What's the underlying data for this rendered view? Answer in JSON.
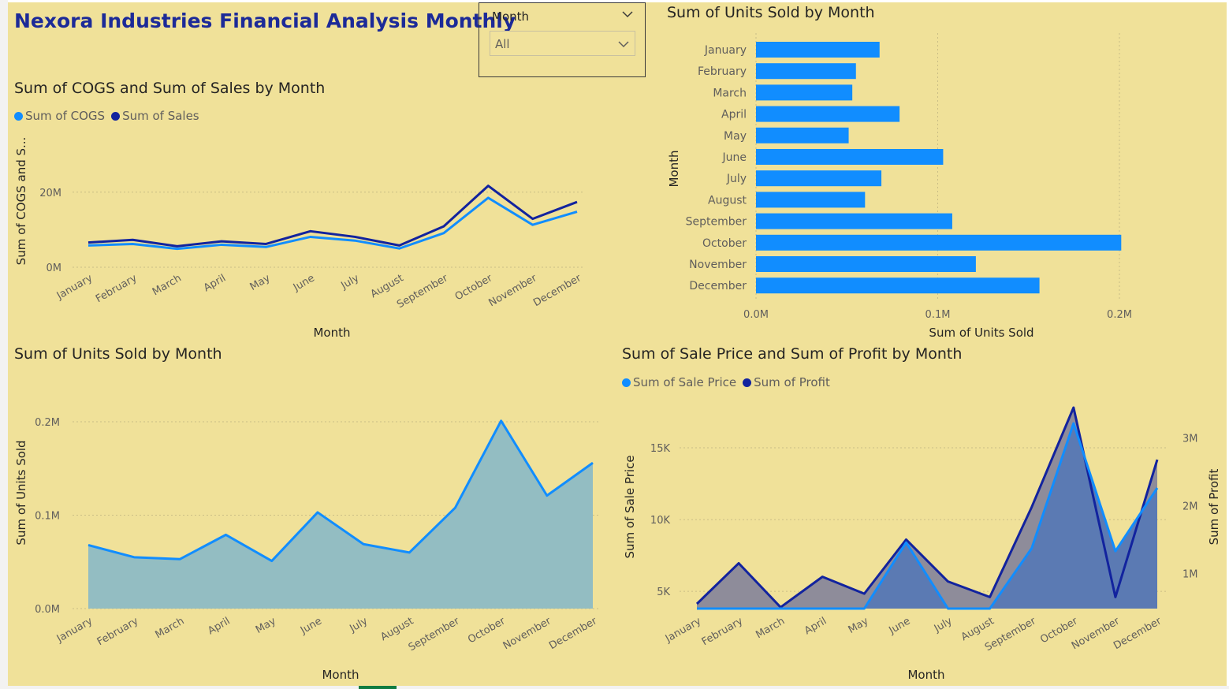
{
  "report": {
    "title": "Nexora Industries Financial Analysis Monthly"
  },
  "colors": {
    "background": "#f0e199",
    "light_blue": "#118dff",
    "dark_navy": "#12239e",
    "area_teal": "#93bdc2",
    "area_gray": "#8e8c9a",
    "area_blue": "#5b7ab3"
  },
  "slicer": {
    "header": "Month",
    "selected": "All"
  },
  "visuals": {
    "cogs_sales": {
      "title": "Sum of COGS and Sum of Sales by Month",
      "legend": [
        "Sum of COGS",
        "Sum of  Sales"
      ],
      "xlabel": "Month",
      "ylabel": "Sum of COGS and S..."
    },
    "units_bar": {
      "title": "Sum of Units Sold by Month",
      "xlabel": "Sum of Units Sold",
      "ylabel": "Month"
    },
    "units_area": {
      "title": "Sum of Units Sold by Month",
      "xlabel": "Month",
      "ylabel": "Sum of Units Sold"
    },
    "price_profit": {
      "title": "Sum of Sale Price and Sum of Profit by Month",
      "legend": [
        "Sum of Sale Price",
        "Sum of Profit"
      ],
      "xlabel": "Month",
      "ylabel_left": "Sum of Sale Price",
      "ylabel_right": "Sum of Profit"
    }
  },
  "chart_data": [
    {
      "type": "line",
      "title": "Sum of COGS and Sum of Sales by Month",
      "categories": [
        "January",
        "February",
        "March",
        "April",
        "May",
        "June",
        "July",
        "August",
        "September",
        "October",
        "November",
        "December"
      ],
      "series": [
        {
          "name": "Sum of COGS",
          "color": "#118dff",
          "values": [
            5.8,
            6.2,
            4.9,
            6.0,
            5.4,
            8.1,
            7.1,
            5.0,
            9.1,
            18.5,
            11.3,
            14.8
          ]
        },
        {
          "name": "Sum of  Sales",
          "color": "#12239e",
          "values": [
            6.6,
            7.3,
            5.6,
            6.9,
            6.2,
            9.6,
            8.1,
            5.8,
            10.9,
            21.7,
            12.9,
            17.4
          ]
        }
      ],
      "ytick_labels": [
        "0M",
        "20M"
      ],
      "ytick_values": [
        0,
        20
      ],
      "ylim": [
        0,
        25
      ],
      "units": "M",
      "xlabel": "Month",
      "ylabel": "Sum of COGS and S...",
      "legend": "top-left",
      "grid": true
    },
    {
      "type": "bar",
      "orientation": "horizontal",
      "title": "Sum of Units Sold by Month",
      "categories": [
        "January",
        "February",
        "March",
        "April",
        "May",
        "June",
        "July",
        "August",
        "September",
        "October",
        "November",
        "December"
      ],
      "values": [
        0.068,
        0.055,
        0.053,
        0.079,
        0.051,
        0.103,
        0.069,
        0.06,
        0.108,
        0.201,
        0.121,
        0.156
      ],
      "color": "#118dff",
      "xtick_labels": [
        "0.0M",
        "0.1M",
        "0.2M"
      ],
      "xtick_values": [
        0,
        0.1,
        0.2
      ],
      "xlim": [
        0,
        0.2
      ],
      "xlabel": "Sum of Units Sold",
      "ylabel": "Month",
      "grid": true
    },
    {
      "type": "area",
      "title": "Sum of Units Sold by Month",
      "categories": [
        "January",
        "February",
        "March",
        "April",
        "May",
        "June",
        "July",
        "August",
        "September",
        "October",
        "November",
        "December"
      ],
      "values": [
        0.068,
        0.055,
        0.053,
        0.079,
        0.051,
        0.103,
        0.069,
        0.06,
        0.108,
        0.201,
        0.121,
        0.156
      ],
      "line_color": "#118dff",
      "fill_color": "#93bdc2",
      "ytick_labels": [
        "0.0M",
        "0.1M",
        "0.2M"
      ],
      "ytick_values": [
        0,
        0.1,
        0.2
      ],
      "ylim": [
        0,
        0.2
      ],
      "xlabel": "Month",
      "ylabel": "Sum of Units Sold",
      "grid": true
    },
    {
      "type": "area",
      "title": "Sum of Sale Price and Sum of Profit by Month",
      "categories": [
        "January",
        "February",
        "March",
        "April",
        "May",
        "June",
        "July",
        "August",
        "September",
        "October",
        "November",
        "December"
      ],
      "series": [
        {
          "name": "Sum of Sale Price",
          "axis": "left",
          "color": "#118dff",
          "values": [
            3800,
            3800,
            3800,
            3800,
            3800,
            8400,
            3800,
            3800,
            8000,
            16700,
            7800,
            12200
          ]
        },
        {
          "name": "Sum of Profit",
          "axis": "right",
          "color": "#12239e",
          "values": [
            0.55,
            1.15,
            0.5,
            0.95,
            0.7,
            1.5,
            0.88,
            0.65,
            1.98,
            3.45,
            0.65,
            2.68
          ]
        }
      ],
      "ytick_labels_left": [
        "5K",
        "10K",
        "15K"
      ],
      "ytick_values_left": [
        5000,
        10000,
        15000
      ],
      "ylim_left": [
        3800,
        17800
      ],
      "ytick_labels_right": [
        "1M",
        "2M",
        "3M"
      ],
      "ytick_values_right": [
        1,
        2,
        3
      ],
      "ylim_right": [
        0.48,
        3.45
      ],
      "xlabel": "Month",
      "ylabel_left": "Sum of Sale Price",
      "ylabel_right": "Sum of Profit",
      "legend": "top-left",
      "grid": true
    }
  ]
}
